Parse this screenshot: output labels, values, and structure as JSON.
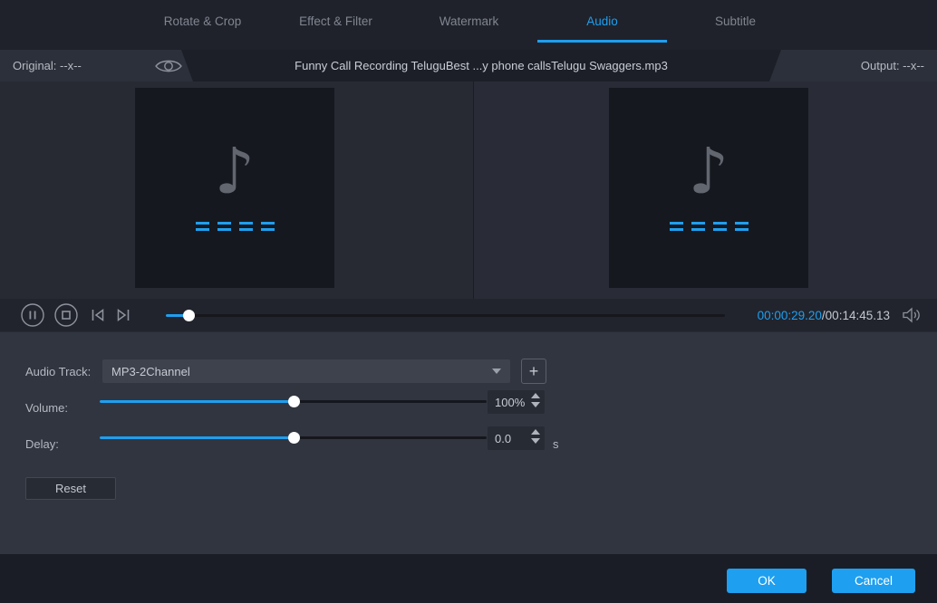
{
  "tabs": [
    {
      "label": "Rotate & Crop",
      "active": false
    },
    {
      "label": "Effect & Filter",
      "active": false
    },
    {
      "label": "Watermark",
      "active": false
    },
    {
      "label": "Audio",
      "active": true
    },
    {
      "label": "Subtitle",
      "active": false
    }
  ],
  "header": {
    "original_label": "Original: --x--",
    "filename": "Funny Call Recording TeluguBest ...y phone callsTelugu Swaggers.mp3",
    "output_label": "Output: --x--"
  },
  "preview": {
    "music_note_icon": "♪"
  },
  "player": {
    "current_time": "00:00:29.20",
    "separator": "/",
    "total_time": "00:14:45.13",
    "seek_percent": 4
  },
  "controls": {
    "audio_track": {
      "label": "Audio Track:",
      "value": "MP3-2Channel",
      "add_button_label": "+"
    },
    "volume": {
      "label": "Volume:",
      "value": "100%",
      "percent": 50
    },
    "delay": {
      "label": "Delay:",
      "value": "0.0",
      "unit": "s",
      "percent": 50
    },
    "reset_label": "Reset"
  },
  "footer": {
    "ok_label": "OK",
    "cancel_label": "Cancel"
  },
  "colors": {
    "accent": "#1e9ff0",
    "panel": "#31353f",
    "bar_dark": "#1f222b"
  }
}
